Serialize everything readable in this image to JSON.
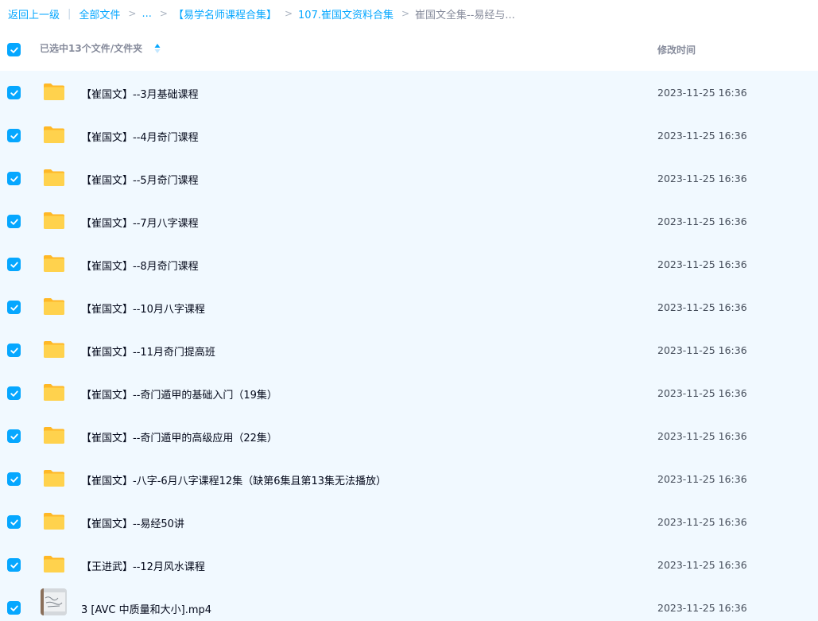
{
  "breadcrumb": {
    "back": "返回上一级",
    "pipe": "|",
    "items": [
      "全部文件",
      "...",
      "【易学名师课程合集】",
      "107.崔国文资料合集",
      "崔国文全集--易经与..."
    ],
    "separator": ">"
  },
  "header": {
    "selection_label": "已选中13个文件/文件夹",
    "time_label": "修改时间"
  },
  "rows": [
    {
      "name": "【崔国文】--3月基础课程",
      "time": "2023-11-25 16:36",
      "icon": "folder-icon"
    },
    {
      "name": "【崔国文】--4月奇门课程",
      "time": "2023-11-25 16:36",
      "icon": "folder-icon"
    },
    {
      "name": "【崔国文】--5月奇门课程",
      "time": "2023-11-25 16:36",
      "icon": "folder-icon"
    },
    {
      "name": "【崔国文】--7月八字课程",
      "time": "2023-11-25 16:36",
      "icon": "folder-icon"
    },
    {
      "name": "【崔国文】--8月奇门课程",
      "time": "2023-11-25 16:36",
      "icon": "folder-icon"
    },
    {
      "name": "【崔国文】--10月八字课程",
      "time": "2023-11-25 16:36",
      "icon": "folder-icon"
    },
    {
      "name": "【崔国文】--11月奇门提高班",
      "time": "2023-11-25 16:36",
      "icon": "folder-icon"
    },
    {
      "name": "【崔国文】--奇门遁甲的基础入门（19集）",
      "time": "2023-11-25 16:36",
      "icon": "folder-icon"
    },
    {
      "name": "【崔国文】--奇门遁甲的高级应用（22集）",
      "time": "2023-11-25 16:36",
      "icon": "folder-icon"
    },
    {
      "name": "【崔国文】-八字-6月八字课程12集（缺第6集且第13集无法播放）",
      "time": "2023-11-25 16:36",
      "icon": "folder-icon"
    },
    {
      "name": "【崔国文】--易经50讲",
      "time": "2023-11-25 16:36",
      "icon": "folder-icon"
    },
    {
      "name": "【王进武】--12月风水课程",
      "time": "2023-11-25 16:36",
      "icon": "folder-icon"
    },
    {
      "name": "3 [AVC 中质量和大小].mp4",
      "time": "2023-11-25 16:36",
      "icon": "video-thumbnail-icon"
    }
  ],
  "colors": {
    "accent": "#06a7ff",
    "row_selected_bg": "#f1f9ff",
    "folder": "#ffc933"
  }
}
